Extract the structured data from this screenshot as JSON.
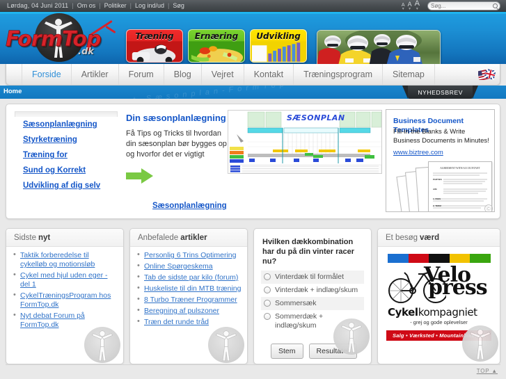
{
  "topbar": {
    "date": "Lørdag, 04 Juni 2011",
    "links": [
      "Om os",
      "Politiker",
      "Log ind/ud",
      "Søg"
    ],
    "separator": "|",
    "font_sizes": [
      "A",
      "A",
      "A"
    ],
    "search_placeholder": "Søg...",
    "search_value": "",
    "search_icon": "magnifier-icon"
  },
  "header": {
    "logo_text": "FormTop",
    "logo_suffix": ".dk",
    "tiles": [
      {
        "label": "Træning",
        "color": "#d81f1f"
      },
      {
        "label": "Ernæring",
        "color": "#52b01a"
      },
      {
        "label": "Udvikling",
        "color": "#f2ce00"
      }
    ],
    "photo_alt": "cyclists-photo"
  },
  "nav": {
    "items": [
      {
        "label": "Forside",
        "active": true
      },
      {
        "label": "Artikler",
        "active": false
      },
      {
        "label": "Forum",
        "active": false
      },
      {
        "label": "Blog",
        "active": false
      },
      {
        "label": "Vejret",
        "active": false
      },
      {
        "label": "Kontakt",
        "active": false
      },
      {
        "label": "Træningsprogram",
        "active": false
      },
      {
        "label": "Sitemap",
        "active": false
      }
    ],
    "flag": "us-uk-flag-icon"
  },
  "crumbbar": {
    "breadcrumb": "Home",
    "newsletter_tab": "NYHEDSBREV",
    "watermark": "FormTop-Magasinet-Sæsonplan-FormTop-Magasinet"
  },
  "feature": {
    "sidebar_links": [
      "Sæsonplanlægning",
      "Styrketræning",
      "Træning for",
      "Sund og Korrekt",
      "Udvikling af dig selv"
    ],
    "title": "Din sæsonplanlægning er vigtig!",
    "body": "Få Tips og Tricks til hvordan din sæsonplan bør bygges op og hvorfor det er vigtigt",
    "arrow": "green-arrow-icon",
    "sheet_title": "SÆSONPLAN",
    "cta": "Sæsonplanlægning"
  },
  "ad": {
    "title": "Business Document Templates",
    "body": "Fill-in the Blanks & Write Business Documents in Minutes!",
    "url": "www.biztree.com"
  },
  "boxes": {
    "news": {
      "title_light": "Sidste",
      "title_bold": "nyt",
      "items": [
        "Taktik forberedelse til cykelløb og motionsløb",
        "Cykel med hjul uden eger - del 1",
        "CykelTræningsProgram hos FormTop.dk",
        "Nyt debat Forum på FormTop.dk"
      ]
    },
    "articles": {
      "title_light": "Anbefalede",
      "title_bold": "artikler",
      "items": [
        "Personlig 6 Trins Optimering",
        "Online Spørgeskema",
        "Tab de sidste par kilo (forum)",
        "Huskeliste til din MTB træning",
        "8 Turbo Træner Programmer",
        "Beregning af pulszoner",
        "Træn det runde tråd"
      ]
    },
    "poll": {
      "question": "Hvilken dækkombination har du på din vinter racer nu?",
      "options": [
        "Vinterdæk til formålet",
        "Vinterdæk + indlæg/skum",
        "Sommersæk",
        "Sommerdæk + indlæg/skum"
      ],
      "vote_button": "Stem",
      "results_button": "Resultater"
    },
    "visit": {
      "title_light": "Et besøg",
      "title_bold": "værd",
      "brand_line1": "Velo",
      "brand_line2": "press",
      "shop_bold": "Cykel",
      "shop_rest": "kompagniet",
      "shop_tagline": "- grej og gode oplevelser",
      "shop_bar": "Salg • Værksted • Mountainbiketure",
      "stripe_colors": [
        "#1a6fd0",
        "#cf0a16",
        "#111111",
        "#f2c200",
        "#3aa60f"
      ]
    }
  },
  "footer": {
    "top_link": "TOP ▲"
  }
}
